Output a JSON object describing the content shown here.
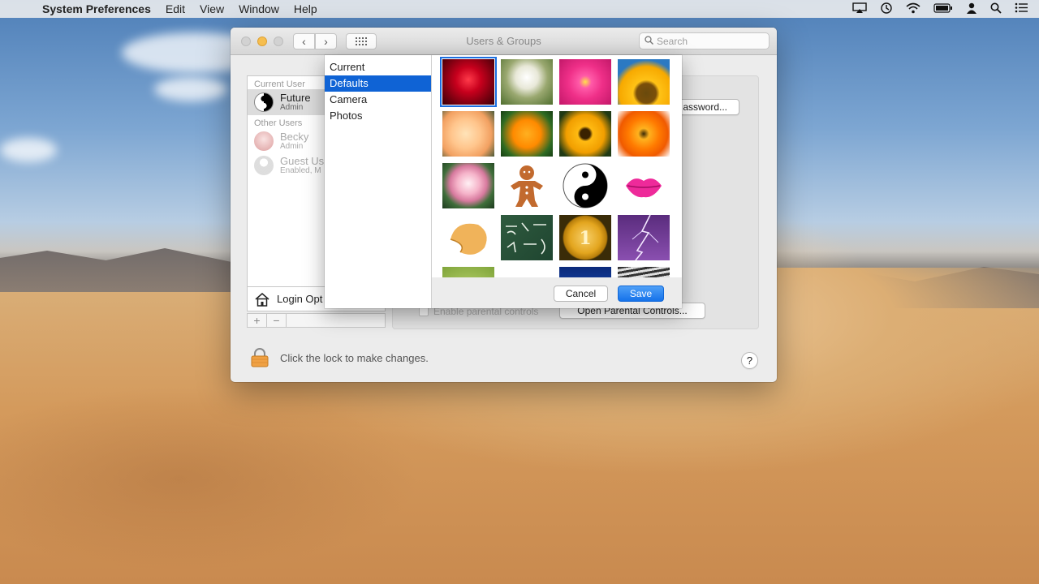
{
  "menubar": {
    "apple": "",
    "app_name": "System Preferences",
    "menus": [
      "Edit",
      "View",
      "Window",
      "Help"
    ],
    "status_icons": [
      "airplay-icon",
      "time-machine-icon",
      "wifi-icon",
      "battery-icon",
      "user-icon",
      "spotlight-icon",
      "notification-center-icon"
    ]
  },
  "window": {
    "title": "Users & Groups",
    "search_placeholder": "Search"
  },
  "users": {
    "current_header": "Current User",
    "current": {
      "name": "Future",
      "role": "Admin"
    },
    "other_header": "Other Users",
    "others": [
      {
        "name": "Becky",
        "role": "Admin"
      },
      {
        "name": "Guest Us",
        "role": "Enabled, M"
      }
    ],
    "login_options": "Login Opt",
    "add": "+",
    "remove": "−"
  },
  "main": {
    "password_button": "assword...",
    "parental_checkbox": "Enable parental controls",
    "parental_button": "Open Parental Controls..."
  },
  "footer": {
    "lock_text": "Click the lock to make changes.",
    "help": "?"
  },
  "picker": {
    "sources": [
      "Current",
      "Defaults",
      "Camera",
      "Photos"
    ],
    "selected_source": "Defaults",
    "pictures": [
      "red-rose",
      "dandelion",
      "pink-dahlia",
      "sunflower",
      "peach-rose",
      "orange-poppy",
      "black-eyed-susan",
      "gerbera-with-bee",
      "lotus",
      "gingerbread-man",
      "yin-yang",
      "lips",
      "fortune-cookie",
      "chalkboard",
      "gold-medal",
      "lightning",
      "green-apple",
      "earth",
      "blue-lightning",
      "zebra"
    ],
    "selected_picture": "red-rose",
    "cancel": "Cancel",
    "save": "Save"
  },
  "colors": {
    "accent": "#0f63d5",
    "save_button": "#1572ea"
  }
}
